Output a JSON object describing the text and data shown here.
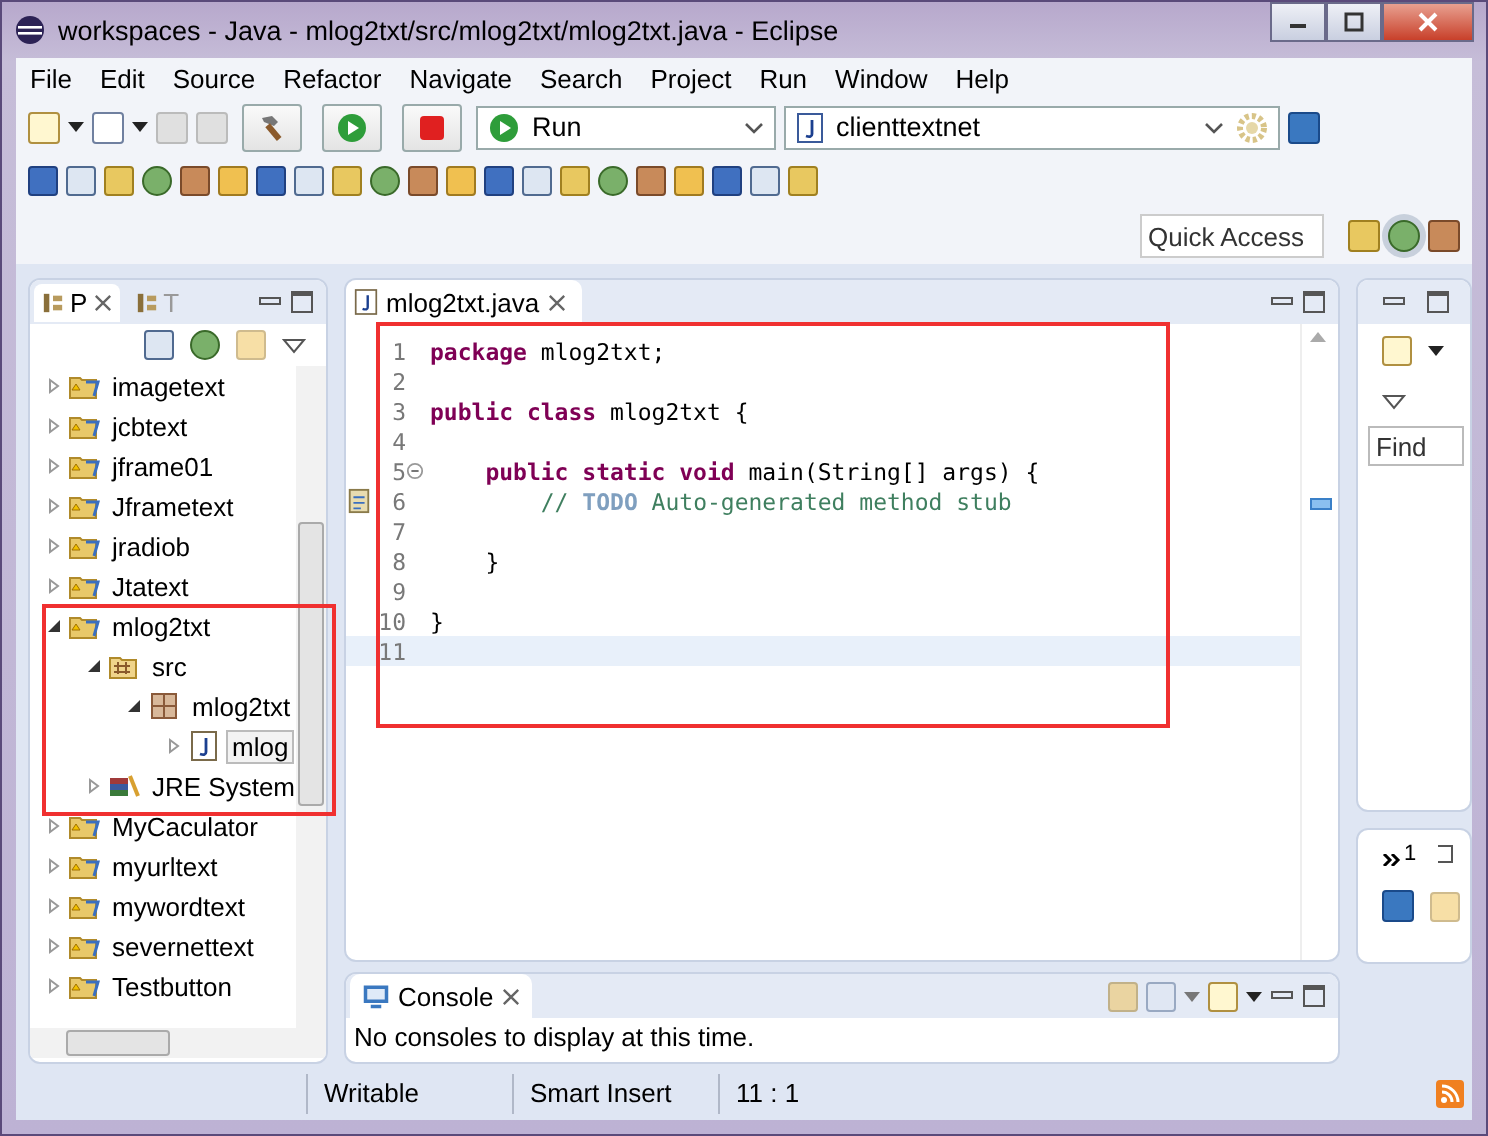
{
  "window": {
    "title": "workspaces - Java - mlog2txt/src/mlog2txt/mlog2txt.java - Eclipse"
  },
  "menu": [
    "File",
    "Edit",
    "Source",
    "Refactor",
    "Navigate",
    "Search",
    "Project",
    "Run",
    "Window",
    "Help"
  ],
  "toolbar": {
    "run_config": "Run",
    "launch_target": "clienttextnet",
    "quick_access": {
      "placeholder": "Quick Access"
    }
  },
  "explorer": {
    "tabs": [
      {
        "label": "P",
        "selected": true
      },
      {
        "label": "T",
        "selected": false
      }
    ],
    "tree": [
      {
        "label": "imagetext",
        "kind": "project",
        "expanded": false,
        "selected": false
      },
      {
        "label": "jcbtext",
        "kind": "project",
        "expanded": false,
        "selected": false
      },
      {
        "label": "jframe01",
        "kind": "project",
        "expanded": false,
        "selected": false
      },
      {
        "label": "Jframetext",
        "kind": "project",
        "expanded": false,
        "selected": false
      },
      {
        "label": "jradiob",
        "kind": "project",
        "expanded": false,
        "selected": false
      },
      {
        "label": "Jtatext",
        "kind": "project",
        "expanded": false,
        "selected": false
      },
      {
        "label": "mlog2txt",
        "kind": "project",
        "expanded": true,
        "selected": false,
        "children": [
          {
            "label": "src",
            "kind": "source-folder",
            "expanded": true,
            "selected": false,
            "children": [
              {
                "label": "mlog2txt",
                "kind": "package",
                "expanded": true,
                "selected": false,
                "children": [
                  {
                    "label": "mlog",
                    "kind": "java-file",
                    "expanded": false,
                    "selected": true
                  }
                ]
              }
            ]
          },
          {
            "label": "JRE System",
            "kind": "library",
            "expanded": false,
            "selected": false
          }
        ]
      },
      {
        "label": "MyCaculator",
        "kind": "project",
        "expanded": false,
        "selected": false
      },
      {
        "label": "myurltext",
        "kind": "project",
        "expanded": false,
        "selected": false
      },
      {
        "label": "mywordtext",
        "kind": "project",
        "expanded": false,
        "selected": false
      },
      {
        "label": "severnettext",
        "kind": "project",
        "expanded": false,
        "selected": false
      },
      {
        "label": "Testbutton",
        "kind": "project",
        "expanded": false,
        "selected": false
      }
    ]
  },
  "editor": {
    "tab": "mlog2txt.java",
    "lines": [
      {
        "number": "1",
        "current": false,
        "foldable": false,
        "task": false,
        "tokens": [
          {
            "kind": "keyword",
            "text": "package"
          },
          {
            "kind": "plain",
            "text": " mlog2txt;"
          }
        ]
      },
      {
        "number": "2",
        "current": false,
        "foldable": false,
        "task": false
      },
      {
        "number": "3",
        "current": false,
        "foldable": false,
        "task": false,
        "tokens": [
          {
            "kind": "keyword",
            "text": "public class"
          },
          {
            "kind": "plain",
            "text": " mlog2txt {"
          }
        ]
      },
      {
        "number": "4",
        "current": false,
        "foldable": false,
        "task": false
      },
      {
        "number": "5",
        "current": false,
        "foldable": true,
        "task": false,
        "tokens": [
          {
            "kind": "keyword",
            "text": "    public static void"
          },
          {
            "kind": "plain",
            "text": " main(String[] args) {"
          }
        ]
      },
      {
        "number": "6",
        "current": false,
        "foldable": false,
        "task": true,
        "tokens": [
          {
            "kind": "comment",
            "text": "        // "
          },
          {
            "kind": "todo",
            "text": "TODO"
          },
          {
            "kind": "comment",
            "text": " Auto-generated method stub"
          }
        ]
      },
      {
        "number": "7",
        "current": false,
        "foldable": false,
        "task": false
      },
      {
        "number": "8",
        "current": false,
        "foldable": false,
        "task": false,
        "tokens": [
          {
            "kind": "plain",
            "text": "    }"
          }
        ]
      },
      {
        "number": "9",
        "current": false,
        "foldable": false,
        "task": false
      },
      {
        "number": "10",
        "current": false,
        "foldable": false,
        "task": false,
        "tokens": [
          {
            "kind": "plain",
            "text": "}"
          }
        ]
      },
      {
        "number": "11",
        "current": true,
        "foldable": false,
        "task": false
      }
    ]
  },
  "outline": {
    "find": {
      "placeholder": "Find"
    }
  },
  "minimized": {
    "count": "1"
  },
  "console": {
    "tab": "Console",
    "message": "No consoles to display at this time."
  },
  "status_bar": [
    "Writable",
    "Smart Insert",
    "11 : 1"
  ]
}
